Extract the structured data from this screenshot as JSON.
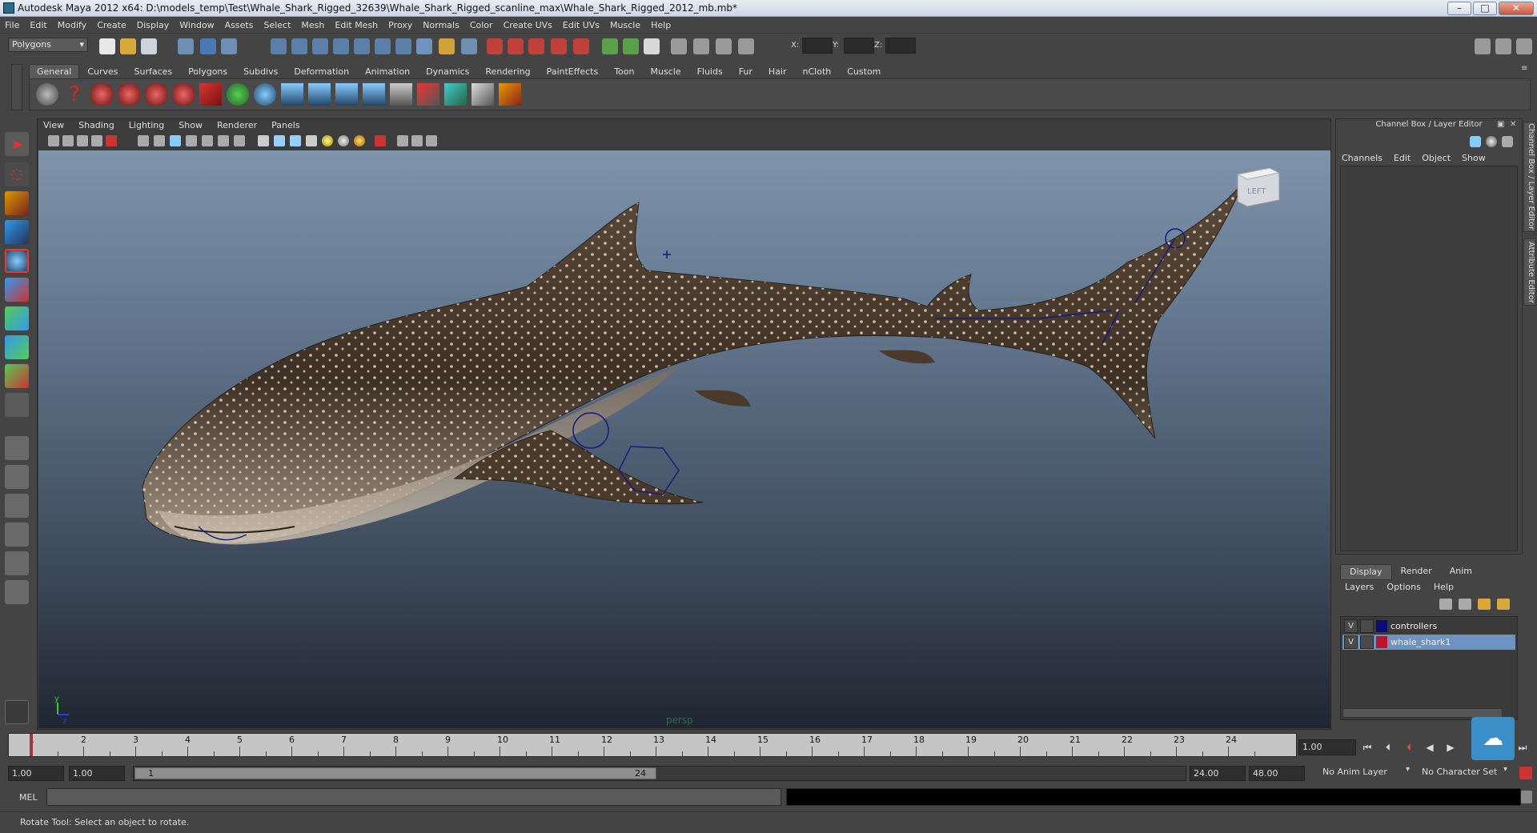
{
  "window": {
    "title": "Autodesk Maya 2012 x64: D:\\models_temp\\Test\\Whale_Shark_Rigged_32639\\Whale_Shark_Rigged_scanline_max\\Whale_Shark_Rigged_2012_mb.mb*",
    "minimize": "–",
    "maximize": "□",
    "close": "✕"
  },
  "menubar": [
    "File",
    "Edit",
    "Modify",
    "Create",
    "Display",
    "Window",
    "Assets",
    "Select",
    "Mesh",
    "Edit Mesh",
    "Proxy",
    "Normals",
    "Color",
    "Create UVs",
    "Edit UVs",
    "Muscle",
    "Help"
  ],
  "statusline": {
    "mode": "Polygons",
    "x_label": "X:",
    "y_label": "Y:",
    "z_label": "Z:"
  },
  "shelf": {
    "tabs": [
      "General",
      "Curves",
      "Surfaces",
      "Polygons",
      "Subdivs",
      "Deformation",
      "Animation",
      "Dynamics",
      "Rendering",
      "PaintEffects",
      "Toon",
      "Muscle",
      "Fluids",
      "Fur",
      "Hair",
      "nCloth",
      "Custom"
    ],
    "active_tab": "General"
  },
  "viewport": {
    "menu": [
      "View",
      "Shading",
      "Lighting",
      "Show",
      "Renderer",
      "Panels"
    ],
    "camera_label": "persp",
    "viewcube_label": "LEFT",
    "axis_y": "y",
    "axis_z": "z"
  },
  "channel_box": {
    "title": "Channel Box / Layer Editor",
    "menu": [
      "Channels",
      "Edit",
      "Object",
      "Show"
    ],
    "side_tabs": [
      "Channel Box / Layer Editor",
      "Attribute Editor"
    ]
  },
  "layer_editor": {
    "tabs": [
      "Display",
      "Render",
      "Anim"
    ],
    "active_tab": "Display",
    "menu": [
      "Layers",
      "Options",
      "Help"
    ],
    "layers": [
      {
        "visible": "V",
        "name": "controllers",
        "color": "#0c0c78",
        "selected": false
      },
      {
        "visible": "V",
        "name": "whale_shark1",
        "color": "#c0102a",
        "selected": true
      }
    ]
  },
  "timeline": {
    "ticks": [
      "1",
      "2",
      "3",
      "4",
      "5",
      "6",
      "7",
      "8",
      "9",
      "10",
      "11",
      "12",
      "13",
      "14",
      "15",
      "16",
      "17",
      "18",
      "19",
      "20",
      "21",
      "22",
      "23",
      "24"
    ],
    "current_frame": "1.00"
  },
  "range": {
    "start": "1.00",
    "playback_start": "1.00",
    "slider_start": "1",
    "slider_end": "24",
    "playback_end": "24.00",
    "end": "48.00",
    "anim_layer": "No Anim Layer",
    "character_set": "No Character Set"
  },
  "command": {
    "label": "MEL"
  },
  "helpline": {
    "text": "Rotate Tool: Select an object to rotate."
  }
}
